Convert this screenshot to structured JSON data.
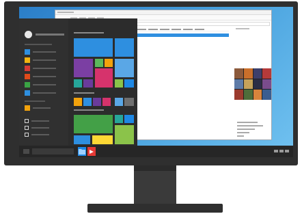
{
  "colors": {
    "bezel": "#2f2f2f",
    "desktop": "#4aa3df",
    "start_menu_bg": "#2c2c2c",
    "taskbar_bg": "#262626",
    "selection": "#2e8fe0"
  },
  "start_menu": {
    "user_icon": "user-avatar-icon",
    "app_list_colors": [
      "#2e8fe0",
      "#f2b411",
      "#d63a36",
      "#e04a1a",
      "#3aa344",
      "#2e8fe0"
    ],
    "recent_color": "#f2a20c",
    "checkbox_count": 3,
    "tiles": [
      {
        "name": "tile-large-blue",
        "color": "#2e8fe0"
      },
      {
        "name": "tile-blue-2",
        "color": "#2e8fe0"
      },
      {
        "name": "tile-purple",
        "color": "#7b3fa3"
      },
      {
        "name": "tile-green-small",
        "color": "#5cb85c"
      },
      {
        "name": "tile-orange-small",
        "color": "#f2a20c"
      },
      {
        "name": "tile-pink",
        "color": "#d6336c"
      },
      {
        "name": "tile-blue-3",
        "color": "#5aa7e6"
      },
      {
        "name": "tile-teal",
        "color": "#26a69a"
      },
      {
        "name": "tile-purple-small",
        "color": "#6a3b9c"
      },
      {
        "name": "tile-lime",
        "color": "#8bc34a"
      },
      {
        "name": "tile-blue-4",
        "color": "#1e88e5"
      },
      {
        "name": "tile-gray",
        "color": "#6f6f6f"
      },
      {
        "name": "tile-green-2",
        "color": "#43a047"
      },
      {
        "name": "tile-yellow",
        "color": "#fdd835"
      },
      {
        "name": "tile-lime-2",
        "color": "#8bc34a"
      },
      {
        "name": "tile-teal-2",
        "color": "#26a69a"
      }
    ]
  },
  "taskbar": {
    "explorer_icon": "folder-icon",
    "explorer_color": "#1e88e5",
    "media_icon": "media-player-icon",
    "media_color": "#e53935"
  }
}
